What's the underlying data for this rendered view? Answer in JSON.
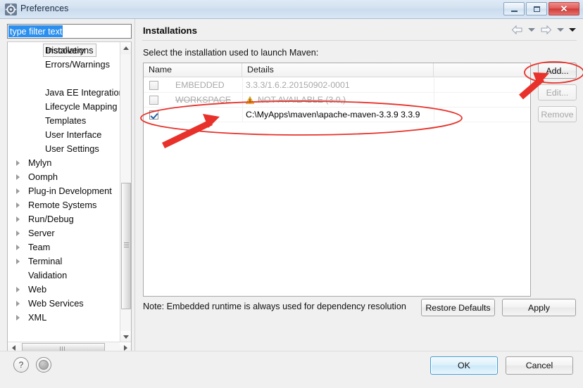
{
  "window": {
    "title": "Preferences",
    "icon": "preferences-gear-icon",
    "controls": {
      "minimize": "minimize-icon",
      "maximize": "maximize-icon",
      "close": "close-icon"
    }
  },
  "sidebar": {
    "filter": {
      "value": "type filter text",
      "placeholder": "type filter text"
    },
    "items": [
      {
        "label": "Discovery",
        "level": 2,
        "expandable": false,
        "selected": false
      },
      {
        "label": "Errors/Warnings",
        "level": 2,
        "expandable": false,
        "selected": false
      },
      {
        "label": "Installations",
        "level": 2,
        "expandable": false,
        "selected": true
      },
      {
        "label": "Java EE Integration",
        "level": 2,
        "expandable": false,
        "selected": false
      },
      {
        "label": "Lifecycle Mapping",
        "level": 2,
        "expandable": false,
        "selected": false
      },
      {
        "label": "Templates",
        "level": 2,
        "expandable": false,
        "selected": false
      },
      {
        "label": "User Interface",
        "level": 2,
        "expandable": false,
        "selected": false
      },
      {
        "label": "User Settings",
        "level": 2,
        "expandable": false,
        "selected": false
      },
      {
        "label": "Mylyn",
        "level": 1,
        "expandable": true,
        "selected": false
      },
      {
        "label": "Oomph",
        "level": 1,
        "expandable": true,
        "selected": false
      },
      {
        "label": "Plug-in Development",
        "level": 1,
        "expandable": true,
        "selected": false
      },
      {
        "label": "Remote Systems",
        "level": 1,
        "expandable": true,
        "selected": false
      },
      {
        "label": "Run/Debug",
        "level": 1,
        "expandable": true,
        "selected": false
      },
      {
        "label": "Server",
        "level": 1,
        "expandable": true,
        "selected": false
      },
      {
        "label": "Team",
        "level": 1,
        "expandable": true,
        "selected": false
      },
      {
        "label": "Terminal",
        "level": 1,
        "expandable": true,
        "selected": false
      },
      {
        "label": "Validation",
        "level": 1,
        "expandable": false,
        "selected": false
      },
      {
        "label": "Web",
        "level": 1,
        "expandable": true,
        "selected": false
      },
      {
        "label": "Web Services",
        "level": 1,
        "expandable": true,
        "selected": false
      },
      {
        "label": "XML",
        "level": 1,
        "expandable": true,
        "selected": false
      }
    ]
  },
  "page": {
    "title": "Installations",
    "instruction": "Select the installation used to launch Maven:",
    "note": "Note: Embedded runtime is always used for dependency resolution",
    "nav": {
      "back_icon": "back-arrow-icon",
      "back_menu_icon": "chevron-down-icon",
      "forward_icon": "forward-arrow-icon",
      "forward_menu_icon": "chevron-down-icon",
      "menu_icon": "chevron-down-filled-icon"
    }
  },
  "table": {
    "columns": [
      "Name",
      "Details",
      ""
    ],
    "rows": [
      {
        "checked": false,
        "name": "EMBEDDED",
        "details": "3.3.3/1.6.2.20150902-0001",
        "disabled": true,
        "strikethrough": false,
        "warning": false
      },
      {
        "checked": false,
        "name": "WORKSPACE",
        "details": "NOT AVAILABLE (3.0,)",
        "disabled": true,
        "strikethrough": true,
        "warning": true,
        "warning_icon": "warning-triangle-icon"
      },
      {
        "checked": true,
        "name": "",
        "details": "C:\\MyApps\\maven\\apache-maven-3.3.9 3.3.9",
        "disabled": false,
        "strikethrough": false,
        "warning": false
      }
    ]
  },
  "buttons": {
    "add": {
      "label": "Add...",
      "enabled": true
    },
    "edit": {
      "label": "Edit...",
      "enabled": false
    },
    "remove": {
      "label": "Remove",
      "enabled": false
    },
    "restore_defaults": {
      "label": "Restore Defaults",
      "enabled": true
    },
    "apply": {
      "label": "Apply",
      "enabled": true
    },
    "ok": {
      "label": "OK",
      "enabled": true,
      "default": true
    },
    "cancel": {
      "label": "Cancel",
      "enabled": true
    }
  },
  "footer": {
    "help_icon": "help-question-icon",
    "help_glyph": "?",
    "apply_all_icon": "apply-to-all-icon"
  },
  "annotations": {
    "accent_color": "#e8312a",
    "ellipse_row_label": "highlight-installation-row",
    "ellipse_add_label": "highlight-add-button",
    "arrow_row_label": "arrow-to-checkbox",
    "arrow_add_label": "arrow-to-add-button"
  }
}
